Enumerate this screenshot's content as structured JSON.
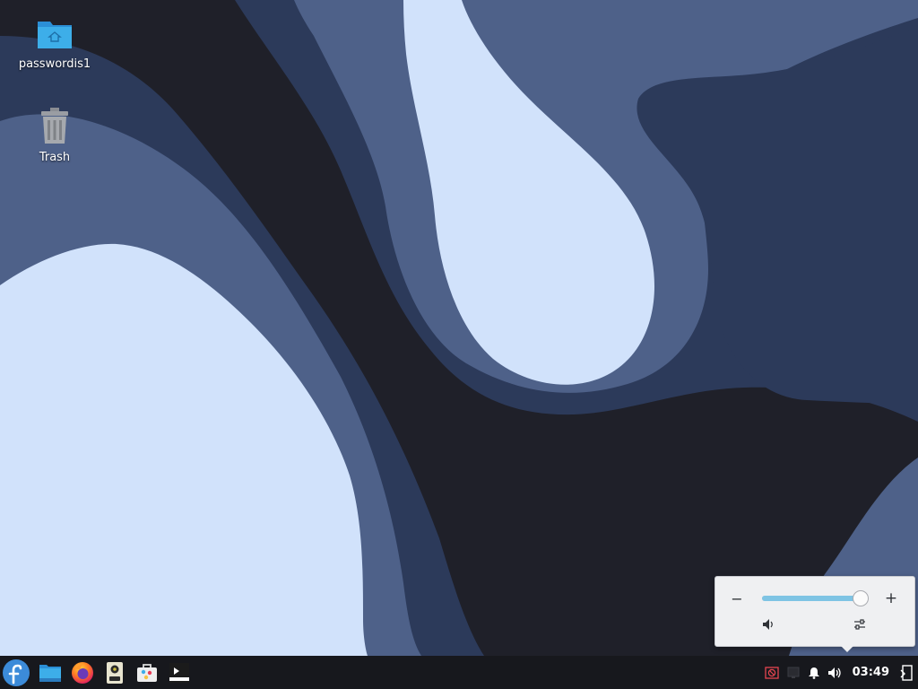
{
  "desktop": {
    "icons": [
      {
        "label": "passwordis1",
        "icon": "home-folder-icon"
      },
      {
        "label": "Trash",
        "icon": "trash-icon"
      }
    ],
    "wallpaper_colors": {
      "dark": "#1f2029",
      "mid_dark": "#2c3a5a",
      "mid": "#4e6189",
      "light": "#d1e2fb"
    }
  },
  "taskbar": {
    "launchers": [
      {
        "name": "application-launcher",
        "icon": "fedora-logo-icon"
      },
      {
        "name": "file-manager",
        "icon": "folder-icon"
      },
      {
        "name": "firefox",
        "icon": "firefox-icon"
      },
      {
        "name": "media-player",
        "icon": "speaker-icon"
      },
      {
        "name": "software-center",
        "icon": "software-bag-icon"
      },
      {
        "name": "terminal",
        "icon": "terminal-icon"
      }
    ],
    "tray": {
      "clock": "03:49"
    }
  },
  "volume_popup": {
    "level": 0.95,
    "minus_label": "−",
    "plus_label": "+",
    "accent": "#7ec4e4"
  }
}
